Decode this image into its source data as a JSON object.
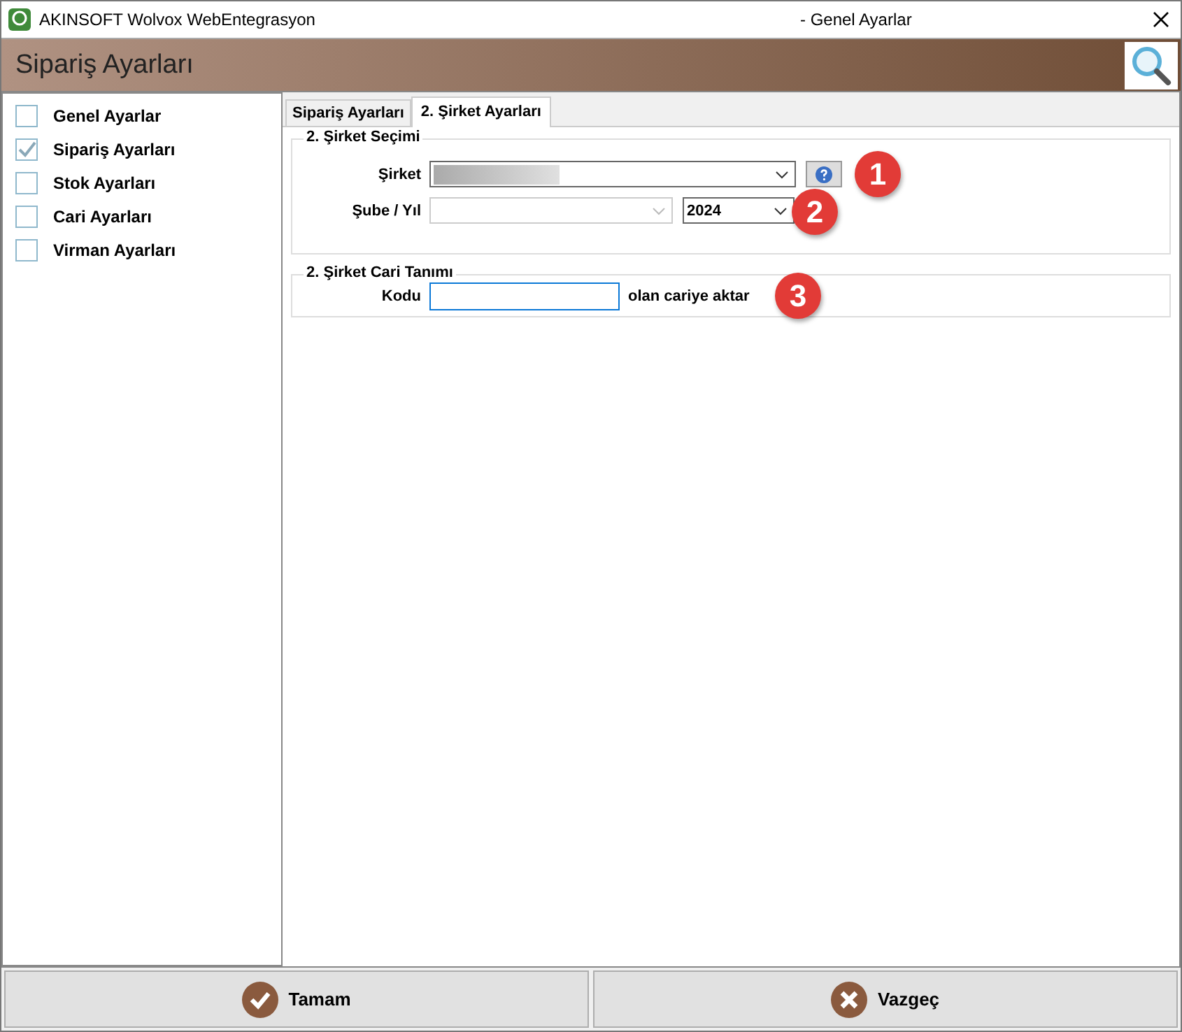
{
  "window": {
    "app_title": "AKINSOFT Wolvox WebEntegrasyon",
    "title": "- Genel Ayarlar"
  },
  "header": {
    "title": "Sipariş Ayarları"
  },
  "sidebar": {
    "items": [
      {
        "label": "Genel Ayarlar",
        "checked": false
      },
      {
        "label": "Sipariş Ayarları",
        "checked": true
      },
      {
        "label": "Stok Ayarları",
        "checked": false
      },
      {
        "label": "Cari Ayarları",
        "checked": false
      },
      {
        "label": "Virman Ayarları",
        "checked": false
      }
    ]
  },
  "tabs": [
    {
      "label": "Sipariş Ayarları",
      "selected": false
    },
    {
      "label": "2. Şirket Ayarları",
      "selected": true
    }
  ],
  "company_group": {
    "title": "2. Şirket Seçimi",
    "company_label": "Şirket",
    "branch_label": "Şube / Yıl",
    "year": "2024",
    "badges": [
      "1",
      "2"
    ]
  },
  "account_group": {
    "title": "2. Şirket Cari Tanımı",
    "code_label": "Kodu",
    "suffix": "olan cariye aktar",
    "badge": "3"
  },
  "buttons": [
    {
      "label": "Tamam",
      "kind": "ok"
    },
    {
      "label": "Vazgeç",
      "kind": "cancel"
    }
  ]
}
